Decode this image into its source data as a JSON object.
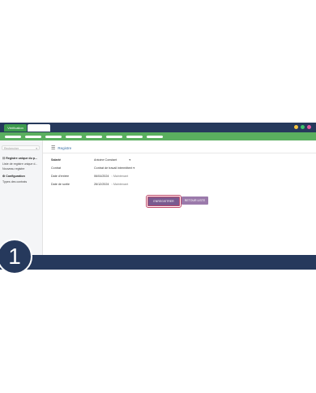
{
  "app": {
    "tab_label": "Vérification",
    "window_dots": [
      "#f5c542",
      "#3ec46d",
      "#e25aa0"
    ]
  },
  "sidebar": {
    "search_placeholder": "Rechercher",
    "items": [
      {
        "label": "Registre unique du p...",
        "header": true,
        "icon": "list-icon"
      },
      {
        "label": "Liste de registre unique d...",
        "header": false
      },
      {
        "label": "Nouveau registre",
        "header": false
      },
      {
        "label": "Configuration",
        "header": true,
        "icon": "gear-icon"
      },
      {
        "label": "Types des contrats",
        "header": false
      }
    ]
  },
  "main": {
    "breadcrumb": "Registre",
    "form": {
      "fields": [
        {
          "label": "Salarié",
          "value": "Antoine Constant",
          "bold": true
        },
        {
          "label": "Contrat",
          "value": "Contrat de travail intermittent"
        },
        {
          "label": "Date d'entrée",
          "value": "06/04/2024",
          "extra": "Maintenant"
        },
        {
          "label": "Date de sortie",
          "value": "26/12/2024",
          "extra": "Maintenant"
        }
      ]
    },
    "buttons": {
      "save": "ENREGISTRER",
      "back": "RETOUR LISTE"
    }
  },
  "step_number": "1"
}
